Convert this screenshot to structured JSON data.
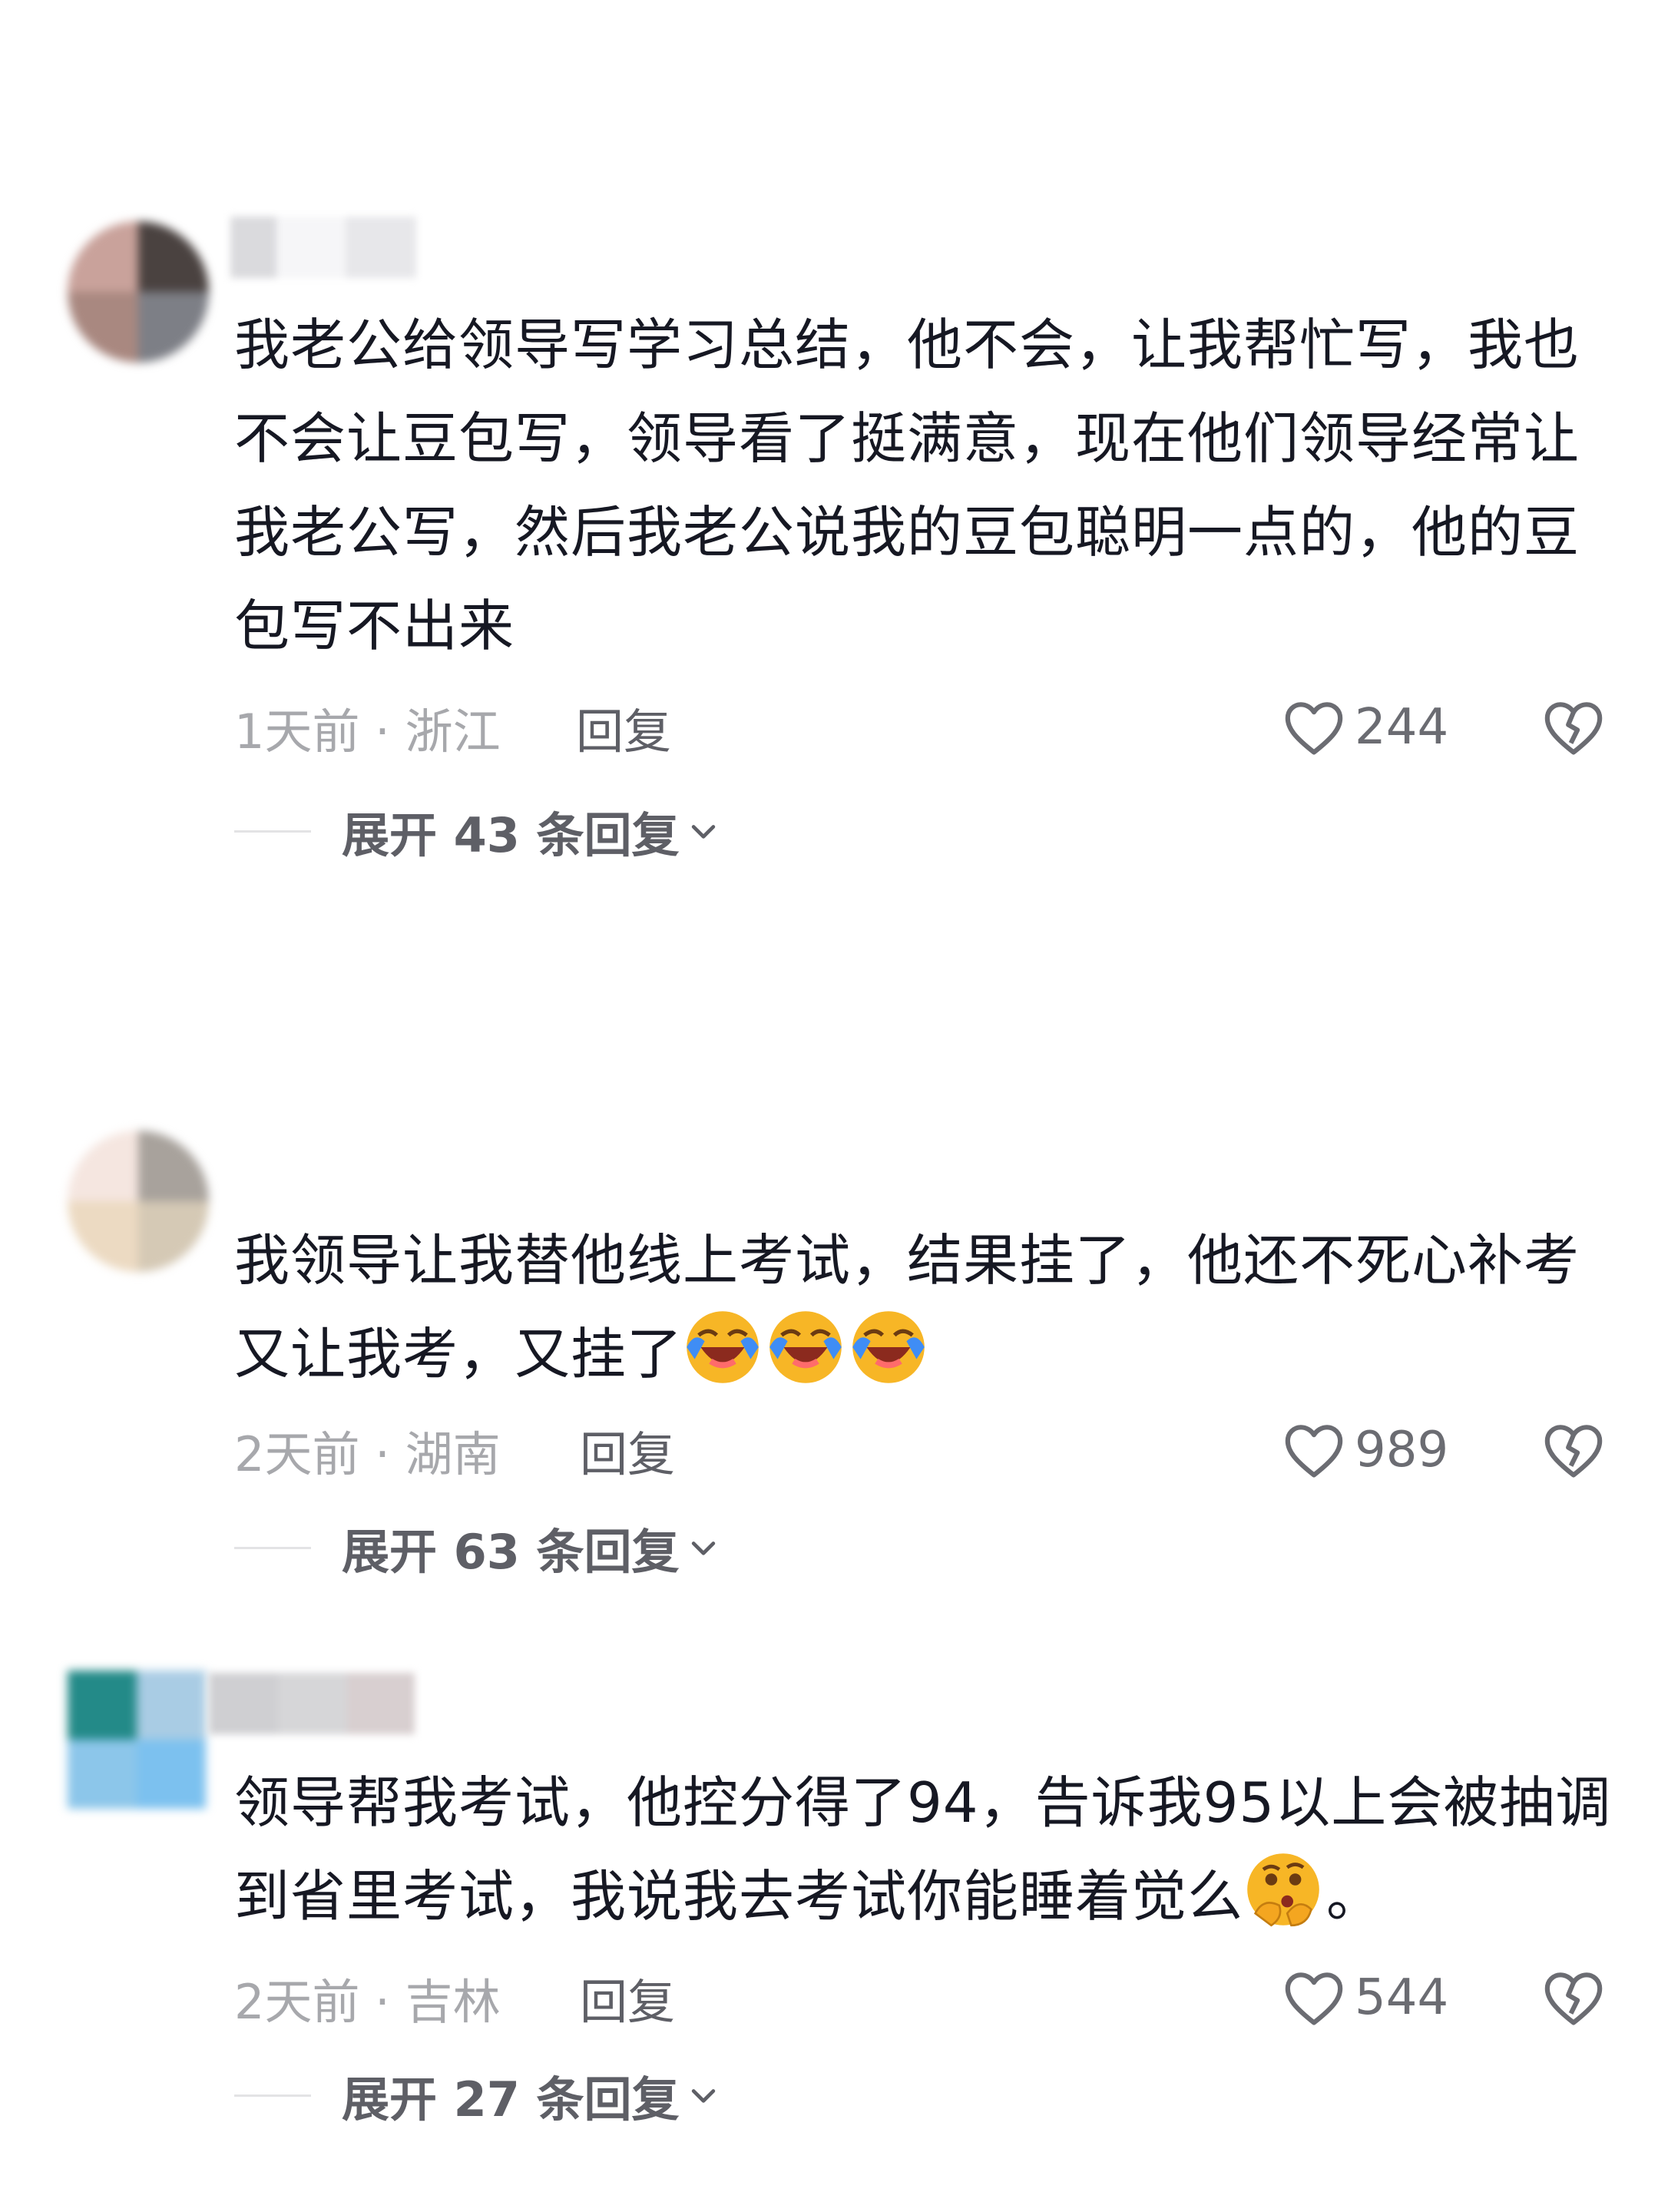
{
  "comments": [
    {
      "text": "我老公给领导写学习总结，他不会，让我帮忙写，我也不会让豆包写，领导看了挺满意，现在他们领导经常让我老公写，然后我老公说我的豆包聪明一点的，他的豆包写不出来",
      "emoji_count": 0,
      "time_location": "1天前 · 浙江",
      "reply_label": "回复",
      "likes": "244",
      "expand_label": "展开 43 条回复"
    },
    {
      "text": "我领导让我替他线上考试，结果挂了，他还不死心补考又让我考，又挂了",
      "emoji_trailing": [
        "crying-laughing-emoji",
        "crying-laughing-emoji",
        "crying-laughing-emoji"
      ],
      "time_location": "2天前 · 湖南",
      "reply_label": "回复",
      "likes": "989",
      "expand_label": "展开 63 条回复"
    },
    {
      "text_before_emoji": "领导帮我考试，他控分得了94，告诉我95以上会被抽调到省里考试，我说我去考试你能睡着觉么",
      "emoji_inline": "thinking-face-emoji",
      "text_after_emoji": "。",
      "time_location": "2天前 · 吉林",
      "reply_label": "回复",
      "likes": "544",
      "expand_label": "展开 27 条回复"
    }
  ],
  "colors": {
    "text_primary": "#161823",
    "text_meta": "#a7a8ac",
    "text_secondary": "#5e5f66",
    "emoji_yellow": "#f7b626",
    "emoji_blue": "#3f8df5"
  }
}
